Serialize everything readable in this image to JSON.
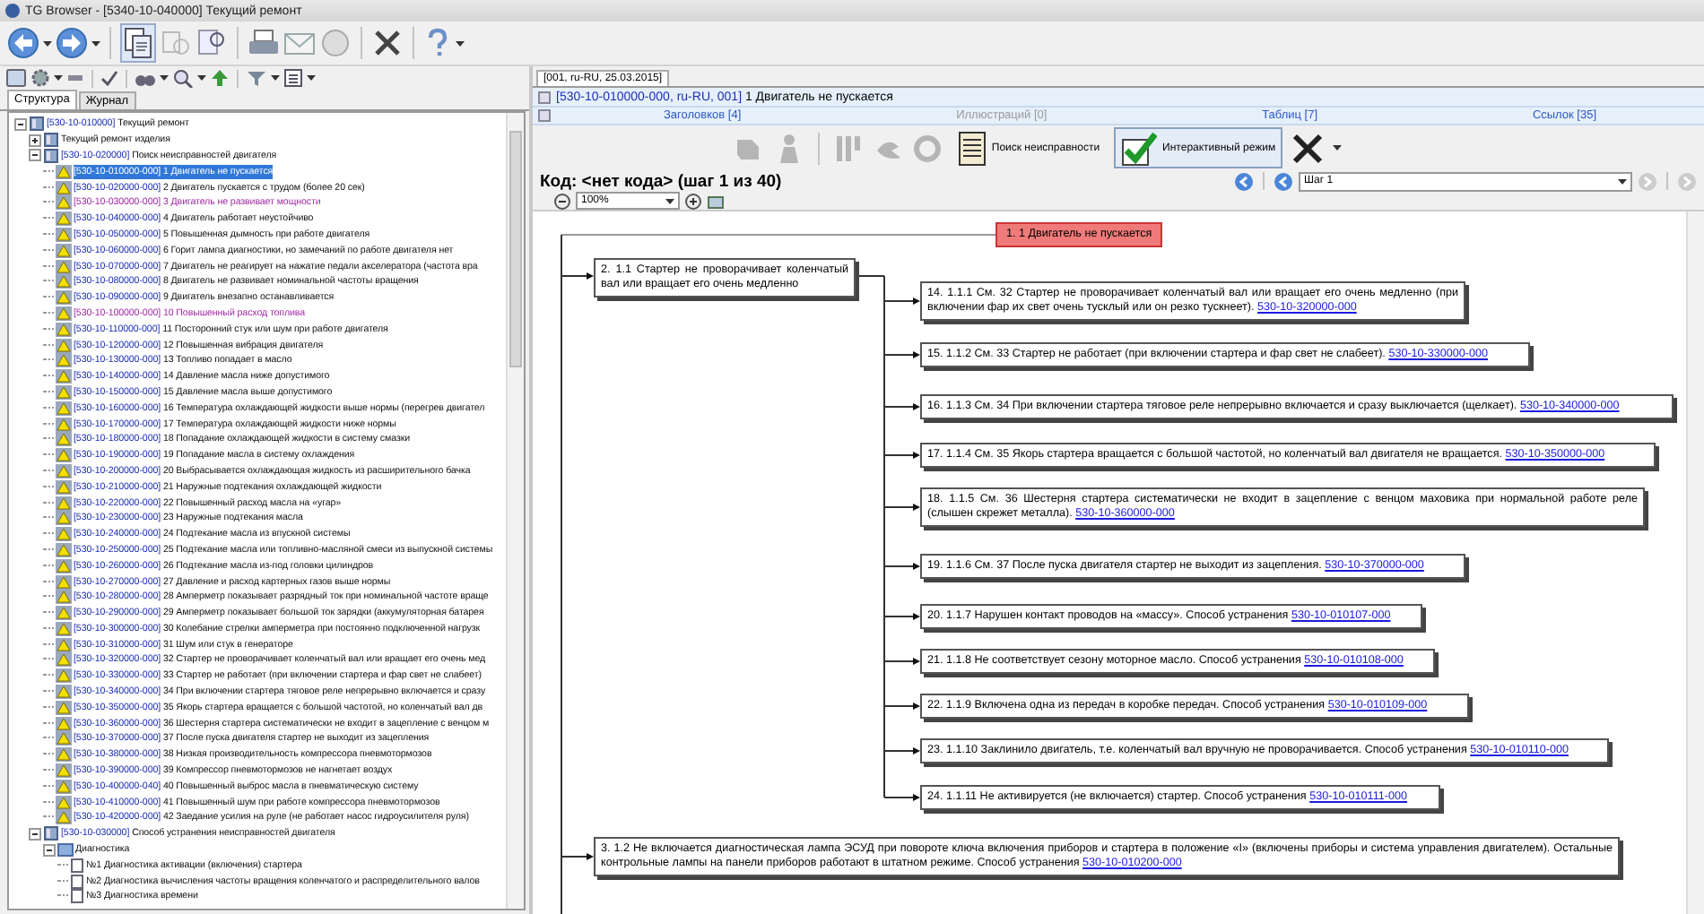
{
  "window": {
    "title": "TG Browser - [5340-10-040000] Текущий ремонт"
  },
  "tree": {
    "tabs": [
      {
        "label": "Структура",
        "selected": true
      },
      {
        "label": "Журнал",
        "selected": false
      }
    ],
    "items": [
      {
        "kind": "book",
        "code": "[530-10-010000]",
        "title": "Текущий ремонт",
        "expanded": true,
        "selected": false,
        "children": [
          {
            "kind": "book",
            "title": "Текущий ремонт изделия",
            "expanded": false,
            "selected": false
          },
          {
            "kind": "book",
            "code": "[530-10-020000]",
            "title": "Поиск неисправностей двигателя",
            "expanded": true,
            "selected": false,
            "children": [
              {
                "kind": "fault",
                "code": "[530-10-010000-000]",
                "title": "1 Двигатель не пускается",
                "selected": true,
                "visited": false
              },
              {
                "kind": "fault",
                "code": "[530-10-020000-000]",
                "title": "2 Двигатель пускается с трудом (более 20 сек)",
                "selected": false,
                "visited": false
              },
              {
                "kind": "fault",
                "code": "[530-10-030000-000]",
                "title": "3 Двигатель не развивает мощности",
                "selected": false,
                "visited": true
              },
              {
                "kind": "fault",
                "code": "[530-10-040000-000]",
                "title": "4 Двигатель работает неустойчиво",
                "selected": false,
                "visited": false
              },
              {
                "kind": "fault",
                "code": "[530-10-050000-000]",
                "title": "5 Повышенная дымность при работе двигателя",
                "selected": false,
                "visited": false
              },
              {
                "kind": "fault",
                "code": "[530-10-060000-000]",
                "title": "6 Горит лампа диагностики, но замечаний по работе двигателя нет",
                "selected": false,
                "visited": false
              },
              {
                "kind": "fault",
                "code": "[530-10-070000-000]",
                "title": "7 Двигатель не реагирует на нажатие педали акселератора (частота вра",
                "selected": false,
                "visited": false
              },
              {
                "kind": "fault",
                "code": "[530-10-080000-000]",
                "title": "8 Двигатель не развивает номинальной частоты вращения",
                "selected": false,
                "visited": false
              },
              {
                "kind": "fault",
                "code": "[530-10-090000-000]",
                "title": "9 Двигатель внезапно останавливается",
                "selected": false,
                "visited": false
              },
              {
                "kind": "fault",
                "code": "[530-10-100000-000]",
                "title": "10 Повышенный расход топлива",
                "selected": false,
                "visited": true
              },
              {
                "kind": "fault",
                "code": "[530-10-110000-000]",
                "title": "11 Посторонний стук или шум при работе двигателя",
                "selected": false,
                "visited": false
              },
              {
                "kind": "fault",
                "code": "[530-10-120000-000]",
                "title": "12 Повышенная вибрация двигателя",
                "selected": false,
                "visited": false
              },
              {
                "kind": "fault",
                "code": "[530-10-130000-000]",
                "title": "13 Топливо попадает в масло",
                "selected": false,
                "visited": false
              },
              {
                "kind": "fault",
                "code": "[530-10-140000-000]",
                "title": "14 Давление масла ниже допустимого",
                "selected": false,
                "visited": false
              },
              {
                "kind": "fault",
                "code": "[530-10-150000-000]",
                "title": "15 Давление масла выше допустимого",
                "selected": false,
                "visited": false
              },
              {
                "kind": "fault",
                "code": "[530-10-160000-000]",
                "title": "16 Температура охлаждающей жидкости выше нормы (перегрев двигател",
                "selected": false,
                "visited": false
              },
              {
                "kind": "fault",
                "code": "[530-10-170000-000]",
                "title": "17 Температура охлаждающей жидкости ниже нормы",
                "selected": false,
                "visited": false
              },
              {
                "kind": "fault",
                "code": "[530-10-180000-000]",
                "title": "18 Попадание охлаждающей жидкости в систему смазки",
                "selected": false,
                "visited": false
              },
              {
                "kind": "fault",
                "code": "[530-10-190000-000]",
                "title": "19 Попадание масла в систему охлаждения",
                "selected": false,
                "visited": false
              },
              {
                "kind": "fault",
                "code": "[530-10-200000-000]",
                "title": "20 Выбрасывается охлаждающая жидкость из расширительного бачка",
                "selected": false,
                "visited": false
              },
              {
                "kind": "fault",
                "code": "[530-10-210000-000]",
                "title": "21 Наружные подтекания охлаждающей жидкости",
                "selected": false,
                "visited": false
              },
              {
                "kind": "fault",
                "code": "[530-10-220000-000]",
                "title": "22 Повышенный расход масла на «угар»",
                "selected": false,
                "visited": false
              },
              {
                "kind": "fault",
                "code": "[530-10-230000-000]",
                "title": "23 Наружные подтекания масла",
                "selected": false,
                "visited": false
              },
              {
                "kind": "fault",
                "code": "[530-10-240000-000]",
                "title": "24 Подтекание масла из впускной системы",
                "selected": false,
                "visited": false
              },
              {
                "kind": "fault",
                "code": "[530-10-250000-000]",
                "title": "25 Подтекание масла или топливно-масляной смеси из выпускной системы",
                "selected": false,
                "visited": false
              },
              {
                "kind": "fault",
                "code": "[530-10-260000-000]",
                "title": "26 Подтекание масла из-под головки цилиндров",
                "selected": false,
                "visited": false
              },
              {
                "kind": "fault",
                "code": "[530-10-270000-000]",
                "title": "27 Давление и расход картерных газов выше нормы",
                "selected": false,
                "visited": false
              },
              {
                "kind": "fault",
                "code": "[530-10-280000-000]",
                "title": "28 Амперметр показывает разрядный ток при номинальной частоте враще",
                "selected": false,
                "visited": false
              },
              {
                "kind": "fault",
                "code": "[530-10-290000-000]",
                "title": "29 Амперметр показывает большой ток зарядки (аккумуляторная батарея",
                "selected": false,
                "visited": false
              },
              {
                "kind": "fault",
                "code": "[530-10-300000-000]",
                "title": "30 Колебание стрелки амперметра при постоянно подключенной нагрузк",
                "selected": false,
                "visited": false
              },
              {
                "kind": "fault",
                "code": "[530-10-310000-000]",
                "title": "31 Шум или стук в генераторе",
                "selected": false,
                "visited": false
              },
              {
                "kind": "fault",
                "code": "[530-10-320000-000]",
                "title": "32 Стартер не проворачивает коленчатый вал или вращает его очень мед",
                "selected": false,
                "visited": false
              },
              {
                "kind": "fault",
                "code": "[530-10-330000-000]",
                "title": "33 Стартер не работает (при включении стартера и фар свет не слабеет)",
                "selected": false,
                "visited": false
              },
              {
                "kind": "fault",
                "code": "[530-10-340000-000]",
                "title": "34 При включении стартера тяговое реле непрерывно включается и сразу",
                "selected": false,
                "visited": false
              },
              {
                "kind": "fault",
                "code": "[530-10-350000-000]",
                "title": "35 Якорь стартера вращается с большой частотой, но коленчатый вал дв",
                "selected": false,
                "visited": false
              },
              {
                "kind": "fault",
                "code": "[530-10-360000-000]",
                "title": "36 Шестерня стартера систематически не входит в зацепление с венцом м",
                "selected": false,
                "visited": false
              },
              {
                "kind": "fault",
                "code": "[530-10-370000-000]",
                "title": "37 После пуска двигателя стартер не выходит из зацепления",
                "selected": false,
                "visited": false
              },
              {
                "kind": "fault",
                "code": "[530-10-380000-000]",
                "title": "38 Низкая производительность компрессора пневмотормозов",
                "selected": false,
                "visited": false
              },
              {
                "kind": "fault",
                "code": "[530-10-390000-000]",
                "title": "39 Компрессор пневмотормозов не нагнетает воздух",
                "selected": false,
                "visited": false
              },
              {
                "kind": "fault",
                "code": "[530-10-400000-040]",
                "title": "40 Повышенный выброс масла в пневматическую систему",
                "selected": false,
                "visited": false
              },
              {
                "kind": "fault",
                "code": "[530-10-410000-000]",
                "title": "41 Повышенный шум при работе компрессора пневмотормозов",
                "selected": false,
                "visited": false
              },
              {
                "kind": "fault",
                "code": "[530-10-420000-000]",
                "title": "42 Заедание усилия на руле (не работает насос гидроусилителя руля)",
                "selected": false,
                "visited": false
              }
            ]
          },
          {
            "kind": "book",
            "code": "[530-10-030000]",
            "title": "Способ устранения неисправностей двигателя",
            "expanded": true,
            "selected": false,
            "children": [
              {
                "kind": "folder",
                "title": "Диагностика",
                "expanded": true,
                "selected": false,
                "children": [
                  {
                    "kind": "page",
                    "title": "№1 Диагностика активации (включения) стартера",
                    "selected": false
                  },
                  {
                    "kind": "page",
                    "title": "№2 Диагностика вычисления частоты вращения коленчатого и распределительного валов",
                    "selected": false
                  },
                  {
                    "kind": "page",
                    "title": "№3 Диагностика времени",
                    "selected": false
                  }
                ]
              }
            ]
          }
        ]
      }
    ]
  },
  "document": {
    "tabs": [
      {
        "label": "[001, ru-RU, 25.03.2015]",
        "selected": true
      }
    ],
    "header": {
      "code": "[530-10-010000-000, ru-RU, 001]",
      "title": "1 Двигатель не пускается"
    },
    "links": [
      {
        "label": "Заголовков [4]",
        "disabled": false
      },
      {
        "label": "Иллюстраций [0]",
        "disabled": true
      },
      {
        "label": "Таблиц [7]",
        "disabled": false
      },
      {
        "label": "Ссылок [35]",
        "disabled": false
      }
    ],
    "mode_buttons": [
      {
        "kind": "search",
        "label": "Поиск неисправности",
        "on": false
      },
      {
        "kind": "interactive",
        "label": "Интерактивный режим",
        "on": true
      }
    ],
    "step_title": "Код: <нет кода> (шаг 1 из 40)",
    "step_select": "Шаг 1",
    "zoom": "100%",
    "diagram": {
      "text": "1. 1 Двигатель не пускается",
      "selected": true,
      "children": [
        {
          "text": "2. 1.1 Стартер не проворачивает коленчатый вал или вращает его очень медленно",
          "selected": false,
          "children": [
            {
              "text": "14. 1.1.1 См. 32 Стартер не проворачивает коленчатый вал или вращает его очень медленно (при включении фар их свет очень тусклый или он резко тускнеет).",
              "link": "530-10-320000-000",
              "selected": false
            },
            {
              "text": "15. 1.1.2 См. 33 Стартер не работает (при включении стартера и фар свет не слабеет).",
              "link": "530-10-330000-000",
              "selected": false
            },
            {
              "text": "16. 1.1.3 См. 34 При включении стартера тяговое реле непрерывно включается и сразу выключается (щелкает).",
              "link": "530-10-340000-000",
              "selected": false
            },
            {
              "text": "17. 1.1.4 См. 35 Якорь стартера вращается с большой частотой, но коленчатый вал двигателя не вращается.",
              "link": "530-10-350000-000",
              "selected": false
            },
            {
              "text": "18. 1.1.5 См. 36 Шестерня стартера систематически не входит в зацепление с венцом маховика при нормальной работе реле (слышен скрежет металла).",
              "link": "530-10-360000-000",
              "selected": false
            },
            {
              "text": "19. 1.1.6 См. 37 После пуска двигателя стартер не выходит из зацепления.",
              "link": "530-10-370000-000",
              "selected": false
            },
            {
              "text": "20. 1.1.7 Нарушен контакт проводов на «массу». Способ устранения",
              "link": "530-10-010107-000",
              "selected": false
            },
            {
              "text": "21. 1.1.8 Не соответствует сезону моторное масло. Способ устранения",
              "link": "530-10-010108-000",
              "selected": false
            },
            {
              "text": "22. 1.1.9 Включена одна из передач в коробке передач. Способ устранения",
              "link": "530-10-010109-000",
              "selected": false
            },
            {
              "text": "23. 1.1.10 Заклинило двигатель, т.е. коленчатый вал вручную не проворачивается. Способ устранения",
              "link": "530-10-010110-000",
              "selected": false
            },
            {
              "text": "24. 1.1.11 Не активируется (не включается) стартер. Способ устранения",
              "link": "530-10-010111-000",
              "selected": false
            }
          ]
        },
        {
          "text": "3. 1.2 Не включается диагностическая лампа ЭСУД при повороте ключа включения приборов и стартера в положение «I» (включены приборы и система управления двигателем). Остальные контрольные лампы на панели приборов работают в штатном режиме. Способ устранения",
          "link": "530-10-010200-000",
          "selected": false
        }
      ]
    }
  }
}
